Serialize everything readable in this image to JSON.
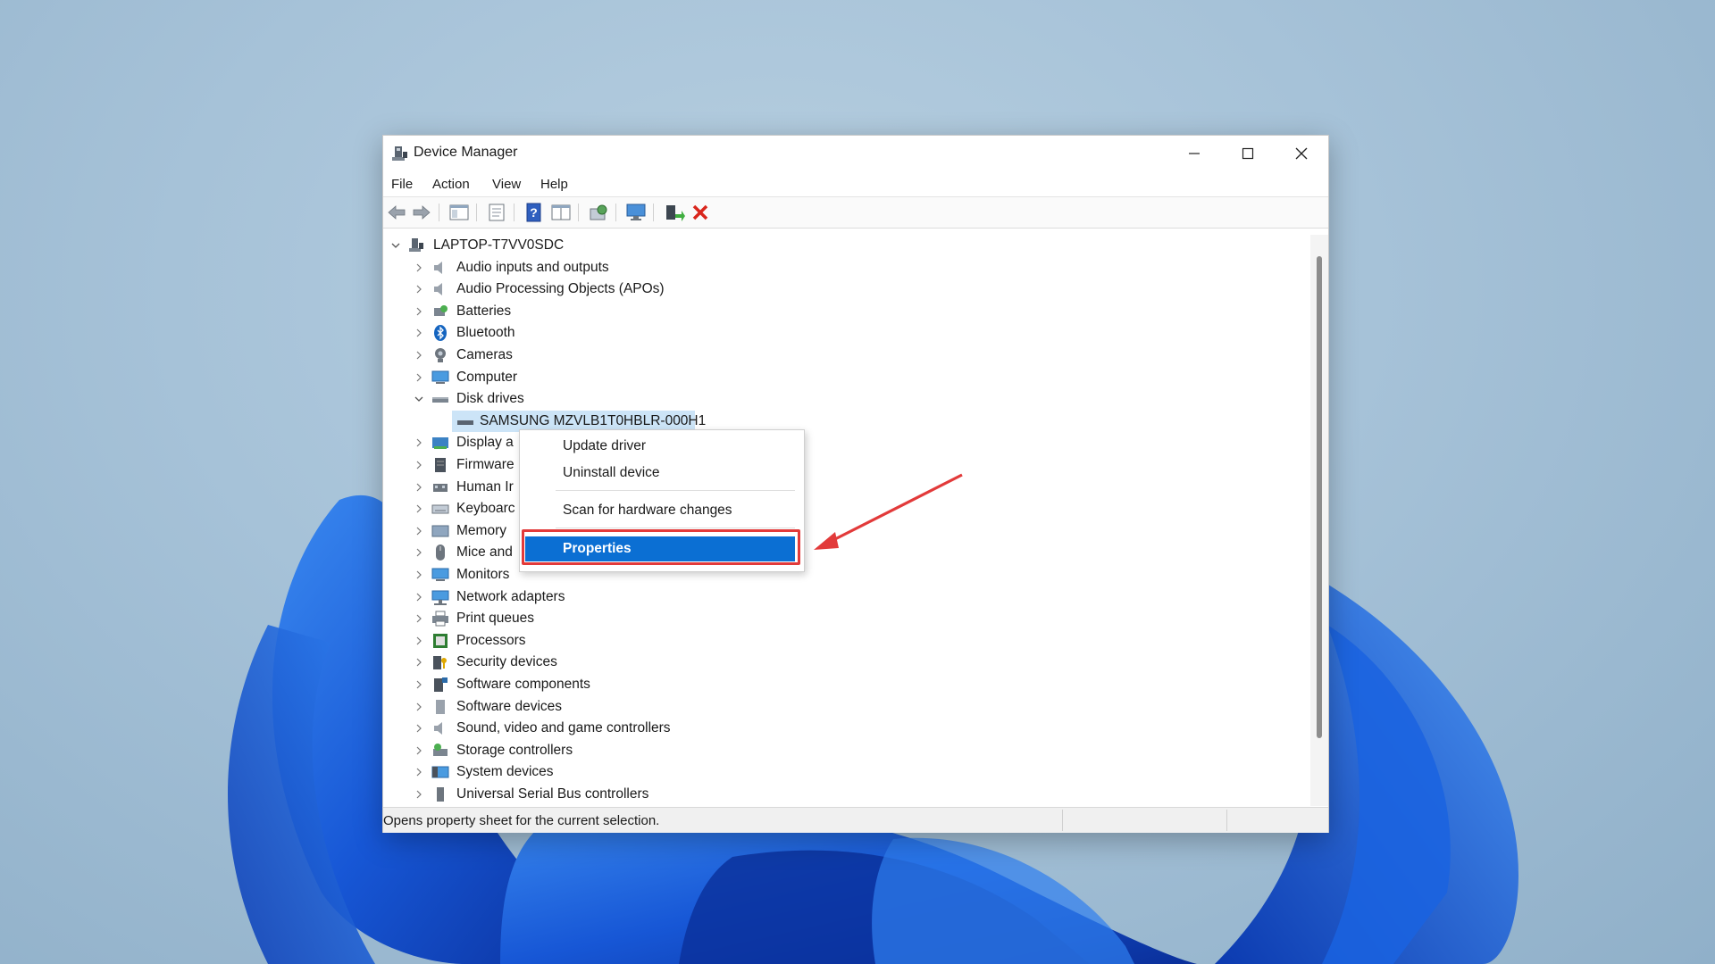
{
  "window": {
    "title": "Device Manager",
    "controls": {
      "minimize": "minimize",
      "maximize": "maximize",
      "close": "close"
    }
  },
  "menu": [
    "File",
    "Action",
    "View",
    "Help"
  ],
  "toolbar": {
    "buttons": [
      "back-icon",
      "forward-icon",
      "show-hide-console-tree-icon",
      "properties-icon",
      "help-icon",
      "view-resources-icon",
      "scan-hardware-icon",
      "monitor-icon",
      "update-driver-icon",
      "uninstall-icon"
    ]
  },
  "tree": {
    "root": "LAPTOP-T7VV0SDC",
    "categories": [
      "Audio inputs and outputs",
      "Audio Processing Objects (APOs)",
      "Batteries",
      "Bluetooth",
      "Cameras",
      "Computer",
      "Disk drives"
    ],
    "disk_child": "SAMSUNG MZVLB1T0HBLR-000H1",
    "categories_after": [
      "Display a",
      "Firmware",
      "Human Ir",
      "Keyboarc",
      "Memory",
      "Mice and",
      "Monitors",
      "Network adapters",
      "Print queues",
      "Processors",
      "Security devices",
      "Software components",
      "Software devices",
      "Sound, video and game controllers",
      "Storage controllers",
      "System devices",
      "Universal Serial Bus controllers"
    ]
  },
  "context_menu": {
    "update_driver": "Update driver",
    "uninstall_device": "Uninstall device",
    "scan": "Scan for hardware changes",
    "properties": "Properties"
  },
  "status": {
    "text": "Opens property sheet for the current selection."
  },
  "colors": {
    "accent": "#0b6fd3",
    "selection": "#cce4f7",
    "annotation": "#e23a3a"
  }
}
